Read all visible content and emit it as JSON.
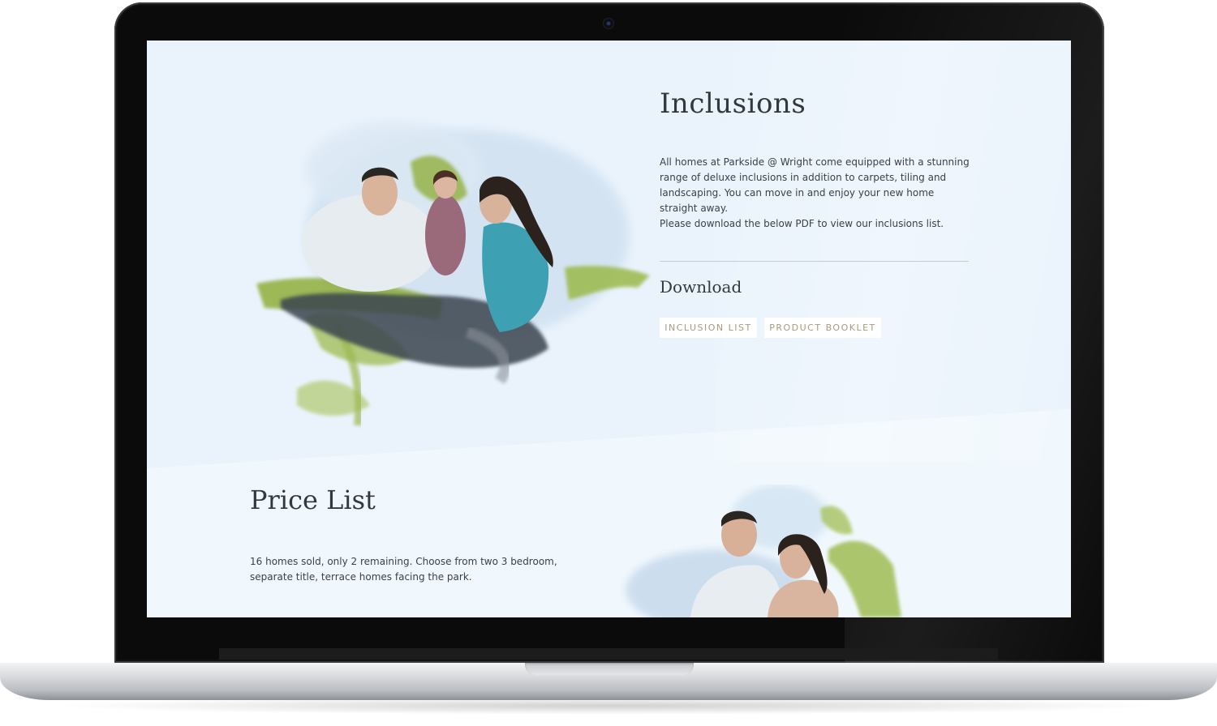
{
  "inclusions": {
    "title": "Inclusions",
    "paragraph_lines": [
      "All homes at Parkside @ Wright come equipped with a stunning",
      "range of deluxe inclusions in addition to carpets, tiling and",
      "landscaping. You can move in and enjoy your new home",
      "straight away.",
      "Please download the below PDF to view our inclusions list."
    ]
  },
  "download": {
    "title": "Download",
    "inclusion_list_label": "INCLUSION LIST",
    "product_booklet_label": "PRODUCT BOOKLET"
  },
  "price_list": {
    "title": "Price List",
    "paragraph_lines": [
      "16 homes sold, only 2 remaining.  Choose from two 3 bedroom,",
      "separate title, terrace homes facing the park."
    ]
  },
  "colors": {
    "screen_bg": "#eaf3fc",
    "lower_bg": "#f1f8fd",
    "heading": "#33383c",
    "button_text": "#a89a7c",
    "paint_green": "#8fae3a",
    "paint_blue": "#bcd3ea"
  }
}
